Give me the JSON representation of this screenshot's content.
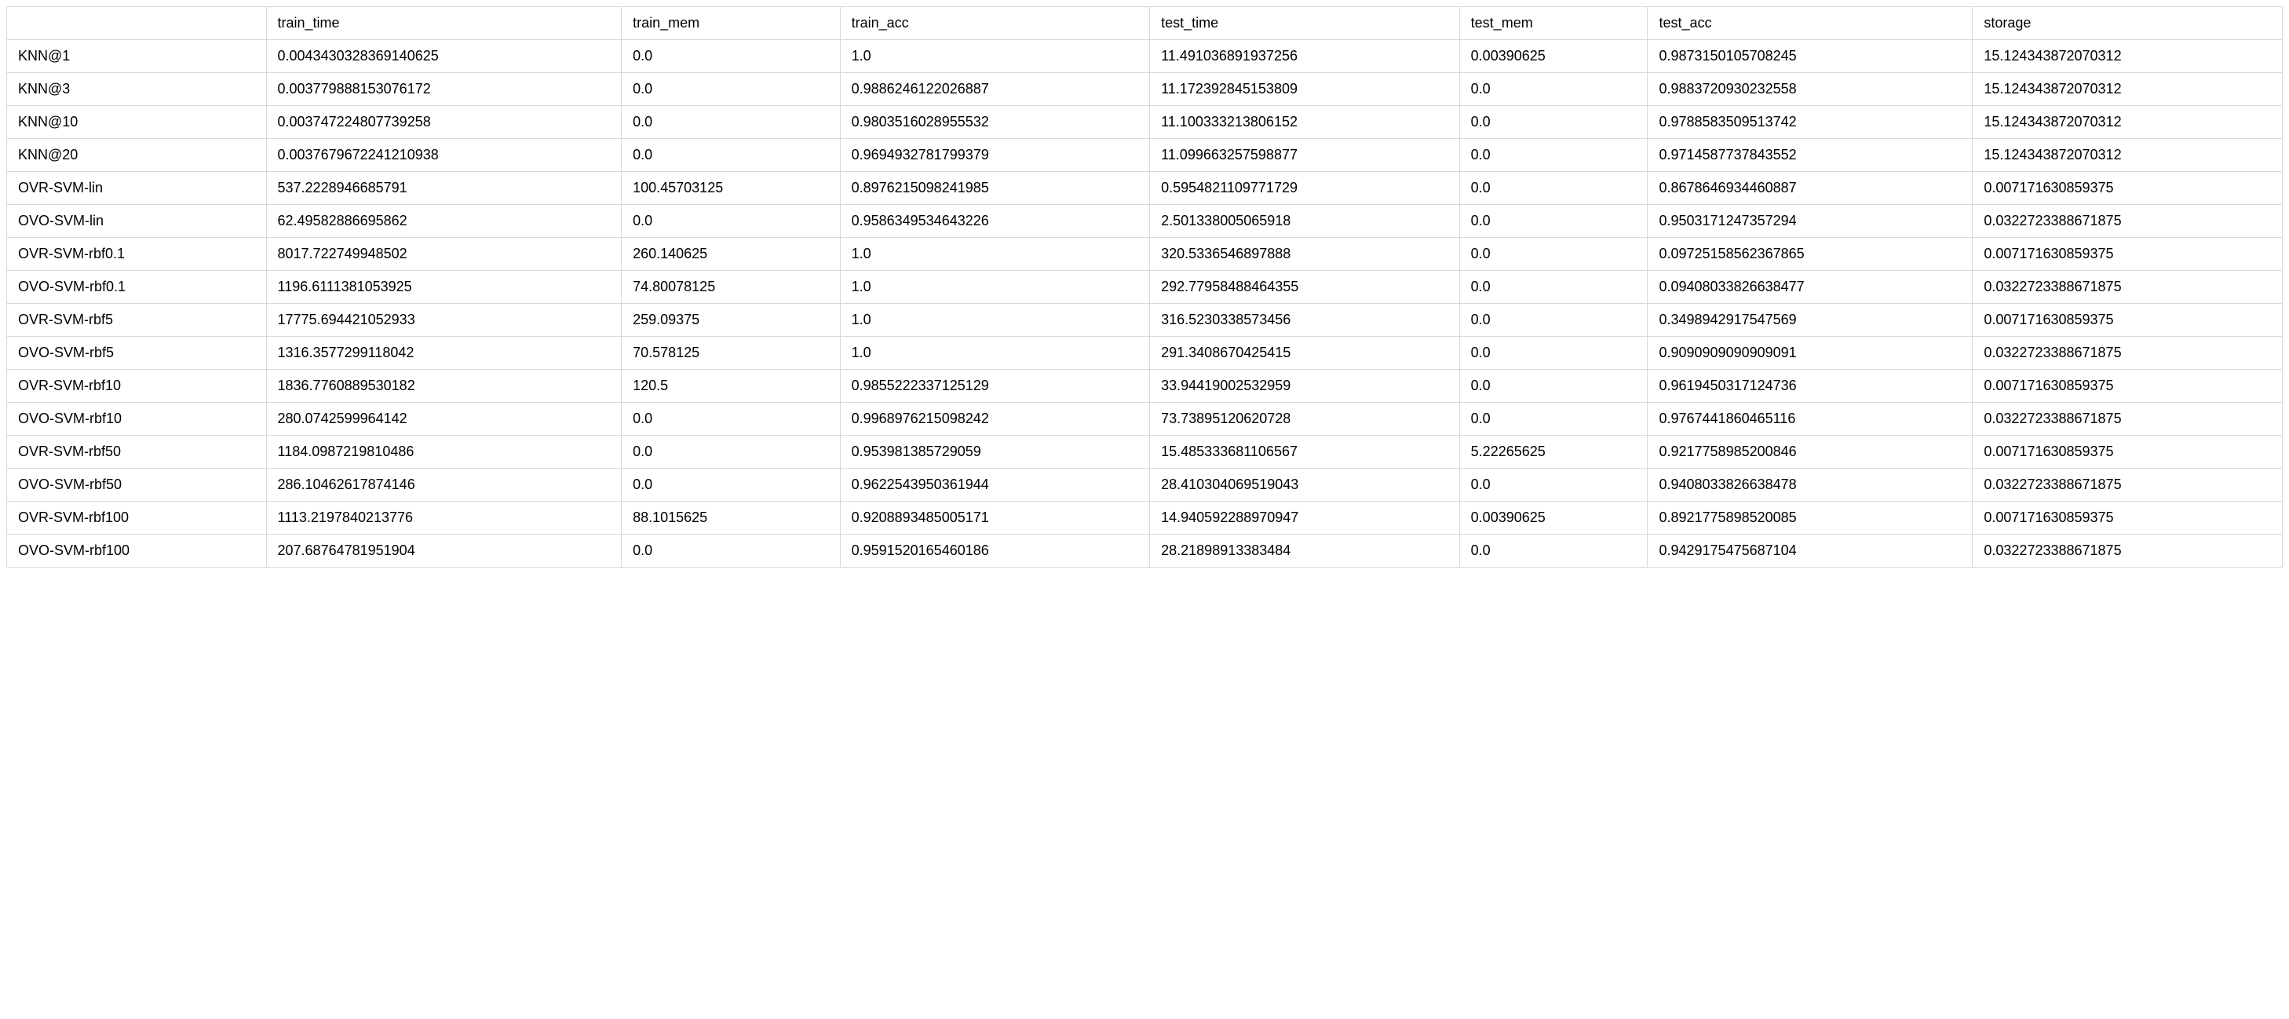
{
  "chart_data": {
    "type": "table",
    "columns": [
      "",
      "train_time",
      "train_mem",
      "train_acc",
      "test_time",
      "test_mem",
      "test_acc",
      "storage"
    ],
    "rows": [
      {
        "name": "KNN@1",
        "train_time": "0.0043430328369140625",
        "train_mem": "0.0",
        "train_acc": "1.0",
        "test_time": "11.491036891937256",
        "test_mem": "0.00390625",
        "test_acc": "0.9873150105708245",
        "storage": "15.124343872070312"
      },
      {
        "name": "KNN@3",
        "train_time": "0.003779888153076172",
        "train_mem": "0.0",
        "train_acc": "0.9886246122026887",
        "test_time": "11.172392845153809",
        "test_mem": "0.0",
        "test_acc": "0.9883720930232558",
        "storage": "15.124343872070312"
      },
      {
        "name": "KNN@10",
        "train_time": "0.003747224807739258",
        "train_mem": "0.0",
        "train_acc": "0.9803516028955532",
        "test_time": "11.100333213806152",
        "test_mem": "0.0",
        "test_acc": "0.9788583509513742",
        "storage": "15.124343872070312"
      },
      {
        "name": "KNN@20",
        "train_time": "0.0037679672241210938",
        "train_mem": "0.0",
        "train_acc": "0.9694932781799379",
        "test_time": "11.099663257598877",
        "test_mem": "0.0",
        "test_acc": "0.9714587737843552",
        "storage": "15.124343872070312"
      },
      {
        "name": "OVR-SVM-lin",
        "train_time": "537.2228946685791",
        "train_mem": "100.45703125",
        "train_acc": "0.8976215098241985",
        "test_time": "0.5954821109771729",
        "test_mem": "0.0",
        "test_acc": "0.8678646934460887",
        "storage": "0.007171630859375"
      },
      {
        "name": "OVO-SVM-lin",
        "train_time": "62.49582886695862",
        "train_mem": "0.0",
        "train_acc": "0.9586349534643226",
        "test_time": "2.501338005065918",
        "test_mem": "0.0",
        "test_acc": "0.9503171247357294",
        "storage": "0.0322723388671875"
      },
      {
        "name": "OVR-SVM-rbf0.1",
        "train_time": "8017.722749948502",
        "train_mem": "260.140625",
        "train_acc": "1.0",
        "test_time": "320.5336546897888",
        "test_mem": "0.0",
        "test_acc": "0.09725158562367865",
        "storage": "0.007171630859375"
      },
      {
        "name": "OVO-SVM-rbf0.1",
        "train_time": "1196.6111381053925",
        "train_mem": "74.80078125",
        "train_acc": "1.0",
        "test_time": "292.77958488464355",
        "test_mem": "0.0",
        "test_acc": "0.09408033826638477",
        "storage": "0.0322723388671875"
      },
      {
        "name": "OVR-SVM-rbf5",
        "train_time": "17775.694421052933",
        "train_mem": "259.09375",
        "train_acc": "1.0",
        "test_time": "316.5230338573456",
        "test_mem": "0.0",
        "test_acc": "0.3498942917547569",
        "storage": "0.007171630859375"
      },
      {
        "name": "OVO-SVM-rbf5",
        "train_time": "1316.3577299118042",
        "train_mem": "70.578125",
        "train_acc": "1.0",
        "test_time": "291.3408670425415",
        "test_mem": "0.0",
        "test_acc": "0.9090909090909091",
        "storage": "0.0322723388671875"
      },
      {
        "name": "OVR-SVM-rbf10",
        "train_time": "1836.7760889530182",
        "train_mem": "120.5",
        "train_acc": "0.9855222337125129",
        "test_time": "33.94419002532959",
        "test_mem": "0.0",
        "test_acc": "0.9619450317124736",
        "storage": "0.007171630859375"
      },
      {
        "name": "OVO-SVM-rbf10",
        "train_time": "280.0742599964142",
        "train_mem": "0.0",
        "train_acc": "0.9968976215098242",
        "test_time": "73.73895120620728",
        "test_mem": "0.0",
        "test_acc": "0.9767441860465116",
        "storage": "0.0322723388671875"
      },
      {
        "name": "OVR-SVM-rbf50",
        "train_time": "1184.0987219810486",
        "train_mem": "0.0",
        "train_acc": "0.953981385729059",
        "test_time": "15.485333681106567",
        "test_mem": "5.22265625",
        "test_acc": "0.9217758985200846",
        "storage": "0.007171630859375"
      },
      {
        "name": "OVO-SVM-rbf50",
        "train_time": "286.10462617874146",
        "train_mem": "0.0",
        "train_acc": "0.9622543950361944",
        "test_time": "28.410304069519043",
        "test_mem": "0.0",
        "test_acc": "0.9408033826638478",
        "storage": "0.0322723388671875"
      },
      {
        "name": "OVR-SVM-rbf100",
        "train_time": "1113.2197840213776",
        "train_mem": "88.1015625",
        "train_acc": "0.9208893485005171",
        "test_time": "14.940592288970947",
        "test_mem": "0.00390625",
        "test_acc": "0.8921775898520085",
        "storage": "0.007171630859375"
      },
      {
        "name": "OVO-SVM-rbf100",
        "train_time": "207.68764781951904",
        "train_mem": "0.0",
        "train_acc": "0.9591520165460186",
        "test_time": "28.21898913383484",
        "test_mem": "0.0",
        "test_acc": "0.9429175475687104",
        "storage": "0.0322723388671875"
      }
    ]
  }
}
